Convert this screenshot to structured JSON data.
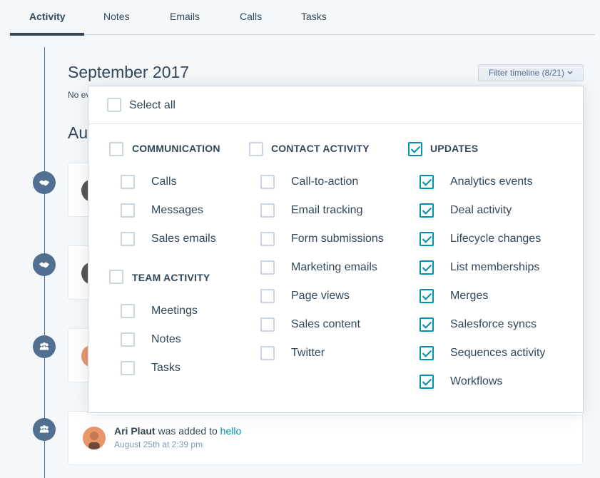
{
  "tabs": [
    {
      "label": "Activity",
      "active": true
    },
    {
      "label": "Notes",
      "active": false
    },
    {
      "label": "Emails",
      "active": false
    },
    {
      "label": "Calls",
      "active": false
    },
    {
      "label": "Tasks",
      "active": false
    }
  ],
  "timeline": {
    "month_title": "September 2017",
    "no_events_partial": "No ev",
    "month2_partial": "Au",
    "filter_button_label": "Filter timeline (8/21)",
    "icons": [
      "handshake-icon",
      "handshake-icon",
      "people-icon",
      "people-icon"
    ]
  },
  "filter": {
    "select_all": {
      "label": "Select all",
      "checked": false
    },
    "groups": {
      "communication": {
        "label": "COMMUNICATION",
        "checked": false,
        "items": [
          {
            "label": "Calls",
            "checked": false
          },
          {
            "label": "Messages",
            "checked": false
          },
          {
            "label": "Sales emails",
            "checked": false
          }
        ]
      },
      "team_activity": {
        "label": "TEAM ACTIVITY",
        "checked": false,
        "items": [
          {
            "label": "Meetings",
            "checked": false
          },
          {
            "label": "Notes",
            "checked": false
          },
          {
            "label": "Tasks",
            "checked": false
          }
        ]
      },
      "contact_activity": {
        "label": "CONTACT ACTIVITY",
        "checked": false,
        "items": [
          {
            "label": "Call-to-action",
            "checked": false
          },
          {
            "label": "Email tracking",
            "checked": false
          },
          {
            "label": "Form submissions",
            "checked": false
          },
          {
            "label": "Marketing emails",
            "checked": false
          },
          {
            "label": "Page views",
            "checked": false
          },
          {
            "label": "Sales content",
            "checked": false
          },
          {
            "label": "Twitter",
            "checked": false
          }
        ]
      },
      "updates": {
        "label": "UPDATES",
        "checked": true,
        "items": [
          {
            "label": "Analytics events",
            "checked": true
          },
          {
            "label": "Deal activity",
            "checked": true
          },
          {
            "label": "Lifecycle changes",
            "checked": true
          },
          {
            "label": "List memberships",
            "checked": true
          },
          {
            "label": "Merges",
            "checked": true
          },
          {
            "label": "Salesforce syncs",
            "checked": true
          },
          {
            "label": "Sequences activity",
            "checked": true
          },
          {
            "label": "Workflows",
            "checked": true
          }
        ]
      }
    }
  },
  "last_event": {
    "actor": "Ari Plaut",
    "action": "was added to",
    "target": "hello",
    "timestamp": "August 25th at 2:39 pm"
  },
  "colors": {
    "accent": "#0091ae",
    "text": "#33475b",
    "timeline": "#516f90"
  }
}
